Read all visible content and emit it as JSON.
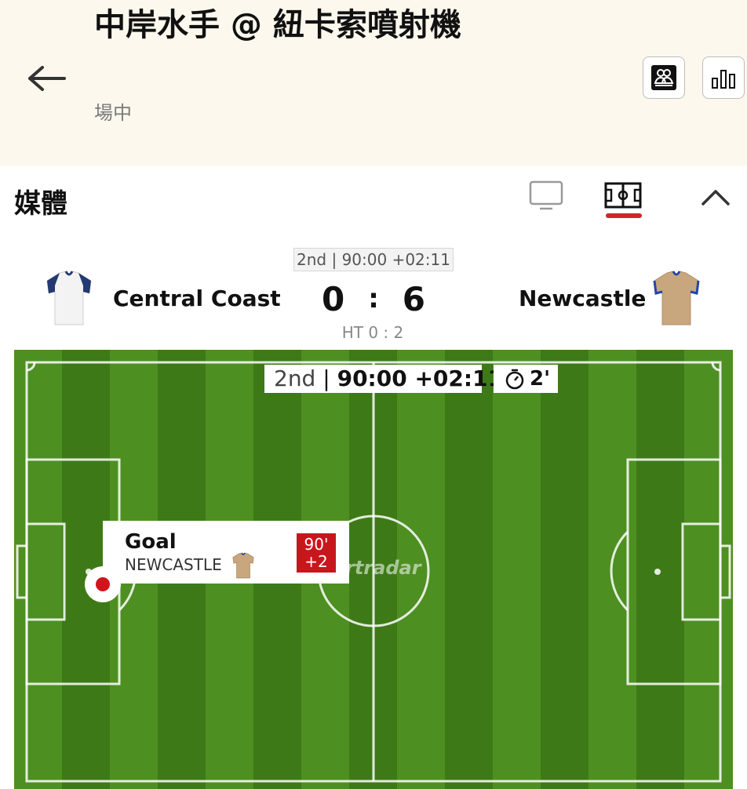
{
  "header": {
    "title": "中岸水手 @ 紐卡索噴射機",
    "status": "場中",
    "back_icon": "arrow-left-icon",
    "lineup_icon": "lineup-icon",
    "stats_icon": "bar-chart-icon"
  },
  "media": {
    "label": "媒體",
    "tv_icon": "tv-icon",
    "pitch_icon": "pitch-icon",
    "collapse_icon": "chevron-up-icon",
    "active_color": "#d0252b"
  },
  "scoreboard": {
    "period": "2nd | 90:00 +02:11",
    "home": {
      "name": "Central Coast",
      "score": "0",
      "jersey_color": "#f3f3f3",
      "jersey_trim": "#233a72"
    },
    "separator": ":",
    "away": {
      "name": "Newcastle",
      "score": "6",
      "jersey_color": "#c8a77f",
      "jersey_trim": "#2146a8"
    },
    "halftime": "HT 0 : 2"
  },
  "pitch": {
    "half": "2nd",
    "clock": "90:00 +02:11",
    "stoppage": "2'",
    "stopwatch_icon": "stopwatch-icon",
    "watermark": "rtradar",
    "grass_dark": "#3d7a17",
    "grass_light": "#4e8f22",
    "event": {
      "title": "Goal",
      "team": "NEWCASTLE",
      "minute_line1": "90'",
      "minute_line2": "+2",
      "minute_color": "#c8161d"
    }
  }
}
